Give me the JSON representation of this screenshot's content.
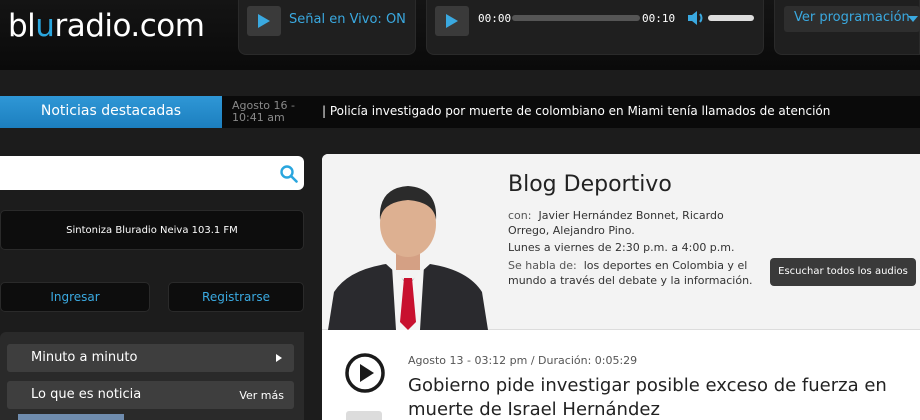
{
  "header": {
    "logo": {
      "part1": "bl",
      "part2": "u",
      "part3": "radio.com"
    },
    "live": {
      "label": "Señal en Vivo: ON"
    },
    "player": {
      "current_time": "00:00",
      "total_time": "00:10",
      "progress": 0
    },
    "schedule_button": "Ver programación"
  },
  "ticker": {
    "label": "Noticias destacadas",
    "date": "Agosto 16 -",
    "time": "10:41 am",
    "headline": "| Policía investigado por muerte de colombiano en Miami tenía llamados de atención"
  },
  "sidebar": {
    "search": {
      "value": "",
      "placeholder": ""
    },
    "sintoniza": "Sintoniza Bluradio Neiva 103.1 FM",
    "login": "Ingresar",
    "register": "Registrarse",
    "minuto": "Minuto a minuto",
    "noticia": "Lo que es noticia",
    "ver_mas": "Ver más"
  },
  "blog": {
    "title": "Blog Deportivo",
    "con_label": "con:",
    "hosts_line1": "Javier Hernández Bonnet, Ricardo",
    "hosts_line2": "Orrego, Alejandro Pino.",
    "schedule": "Lunes a viernes de 2:30 p.m. a 4:00 p.m.",
    "topic_label": "Se habla de:",
    "topic_line1": "los deportes en Colombia y el",
    "topic_line2": "mundo a través del debate y la información.",
    "listen_all": "Escuchar todos los audios"
  },
  "episode": {
    "meta": "Agosto 13 - 03:12 pm / Duración: 0:05:29",
    "title_line1": "Gobierno pide investigar posible exceso de fuerza en",
    "title_line2": "muerte de Israel Hernández"
  },
  "colors": {
    "accent": "#2aa6de",
    "ticker_label": "#1c7fbf",
    "dark": "#0a0a0a"
  }
}
